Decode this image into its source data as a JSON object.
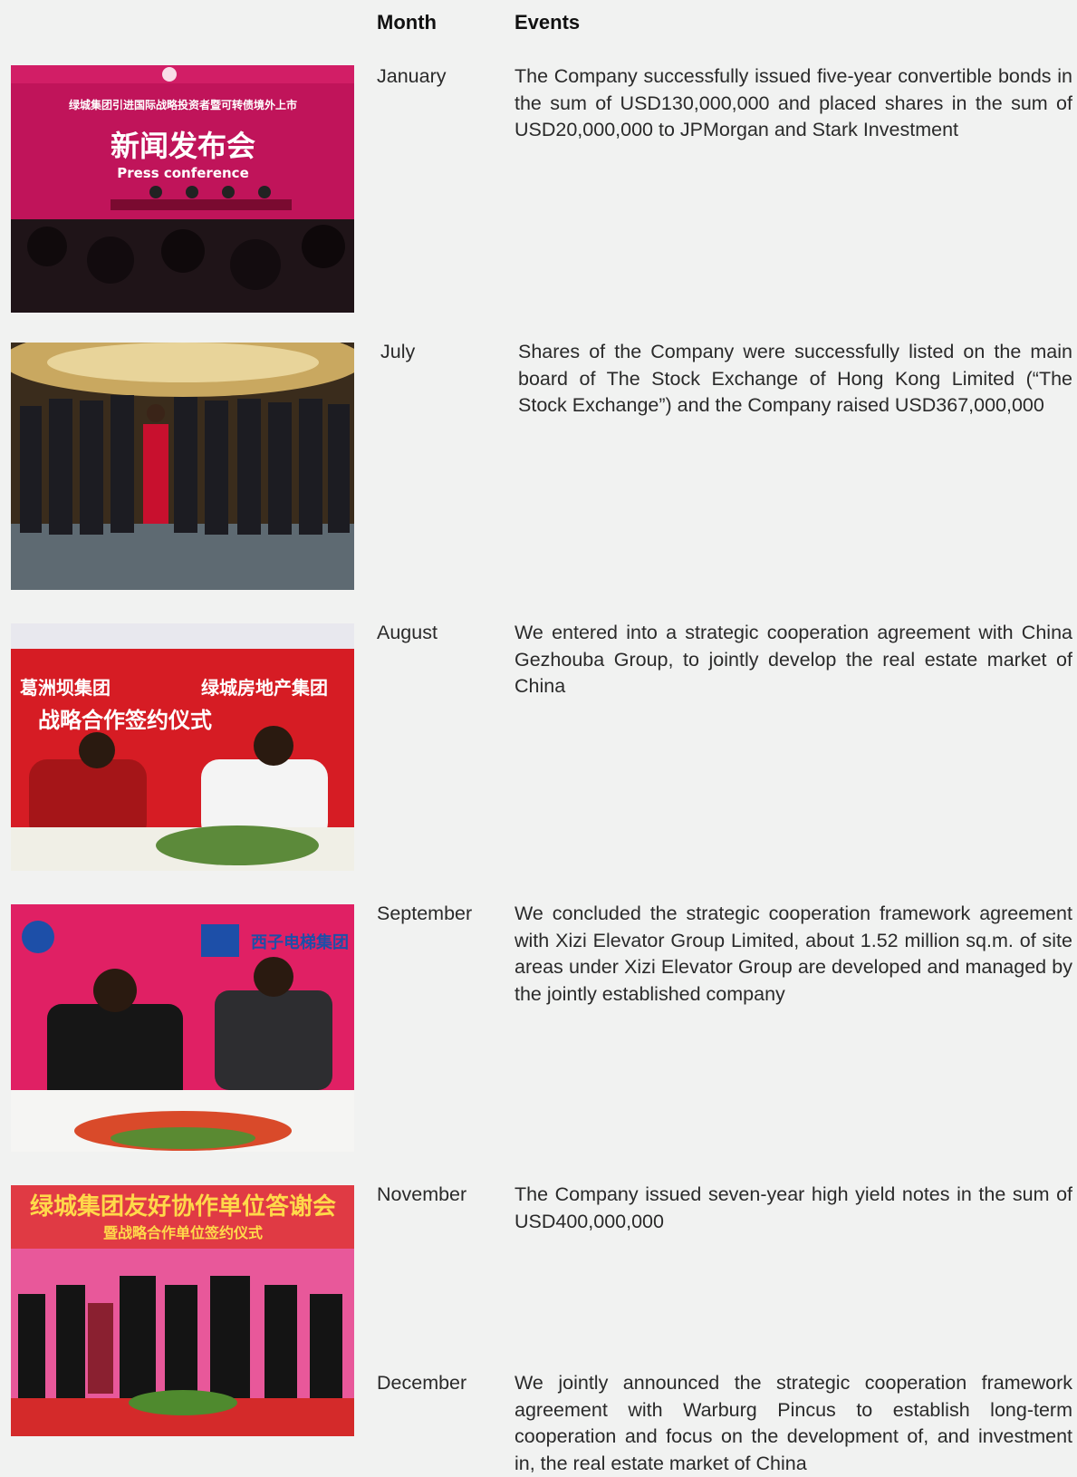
{
  "header": {
    "month": "Month",
    "events": "Events"
  },
  "rows": [
    {
      "month": "January",
      "event": "The Company successfully issued five-year convertible bonds in the sum of USD130,000,000 and placed shares in the sum of USD20,000,000 to JPMorgan and Stark Investment"
    },
    {
      "month": "July",
      "event": "Shares of the Company were successfully listed on the main board of The Stock Exchange of Hong Kong Limited (“The Stock Exchange”) and the Company raised USD367,000,000"
    },
    {
      "month": "August",
      "event": "We entered into a strategic cooperation agreement with China Gezhouba Group, to jointly develop the real estate market of China"
    },
    {
      "month": "September",
      "event": "We concluded the strategic cooperation framework agreement with Xizi Elevator Group Limited, about 1.52 million sq.m. of site areas under Xizi Elevator Group are developed and managed by the jointly established company"
    },
    {
      "month": "November",
      "event": "The Company issued seven-year high yield notes in the sum of USD400,000,000"
    },
    {
      "month": "December",
      "event": "We jointly announced the strategic cooperation framework agreement with Warburg Pincus to establish long-term cooperation and focus on the development of, and investment in, the real estate market of China"
    }
  ],
  "photos": {
    "press": {
      "headline": "新闻发布会",
      "subline": "Press conference",
      "banner": "绿城集团引进国际战略投资者暨可转债境外上市"
    },
    "gezhouba": {
      "banner_left": "葛洲坝集团",
      "banner_right": "绿城房地产集团",
      "banner_line2": "战略合作签约仪式"
    },
    "xizi": {
      "banner_right": "西子电梯集团"
    },
    "partners": {
      "banner": "绿城集团友好协作单位答谢会",
      "banner_line2": "暨战略合作单位签约仪式"
    }
  }
}
